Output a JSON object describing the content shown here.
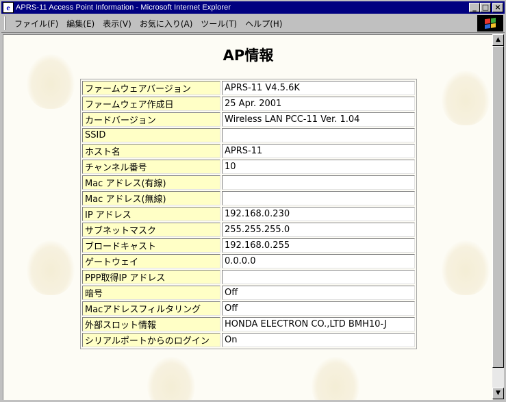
{
  "window": {
    "title": "APRS-11 Access Point Information - Microsoft Internet Explorer",
    "title_icon": "ie-page-icon",
    "buttons": {
      "minimize": "_",
      "maximize": "□",
      "close": "×"
    }
  },
  "menu": {
    "items": [
      {
        "label": "ファイル(F)",
        "name": "menu-file"
      },
      {
        "label": "編集(E)",
        "name": "menu-edit"
      },
      {
        "label": "表示(V)",
        "name": "menu-view"
      },
      {
        "label": "お気に入り(A)",
        "name": "menu-favorites"
      },
      {
        "label": "ツール(T)",
        "name": "menu-tools"
      },
      {
        "label": "ヘルプ(H)",
        "name": "menu-help"
      }
    ]
  },
  "page": {
    "title": "AP情報"
  },
  "info_table": {
    "rows": [
      {
        "label": "ファームウェアバージョン",
        "value": "APRS-11 V4.5.6K"
      },
      {
        "label": "ファームウェア作成日",
        "value": "25 Apr. 2001"
      },
      {
        "label": "カードバージョン",
        "value": "Wireless LAN PCC-11 Ver. 1.04"
      },
      {
        "label": "SSID",
        "value": ""
      },
      {
        "label": "ホスト名",
        "value": "APRS-11"
      },
      {
        "label": "チャンネル番号",
        "value": "10"
      },
      {
        "label": "Mac アドレス(有線)",
        "value": ""
      },
      {
        "label": "Mac アドレス(無線)",
        "value": ""
      },
      {
        "label": "IP アドレス",
        "value": "192.168.0.230"
      },
      {
        "label": "サブネットマスク",
        "value": "255.255.255.0"
      },
      {
        "label": "ブロードキャスト",
        "value": "192.168.0.255"
      },
      {
        "label": "ゲートウェイ",
        "value": "0.0.0.0"
      },
      {
        "label": "PPP取得IP アドレス",
        "value": ""
      },
      {
        "label": "暗号",
        "value": "Off"
      },
      {
        "label": "Macアドレスフィルタリング",
        "value": "Off"
      },
      {
        "label": "外部スロット情報",
        "value": "HONDA ELECTRON CO.,LTD BMH10-J"
      },
      {
        "label": "シリアルポートからのログイン",
        "value": "On"
      }
    ]
  },
  "scrollbar": {
    "up_arrow": "▲",
    "down_arrow": "▼"
  },
  "colors": {
    "titlebar": "#000080",
    "label_cell": "#ffffc6",
    "page_background": "#fdfcf5"
  }
}
